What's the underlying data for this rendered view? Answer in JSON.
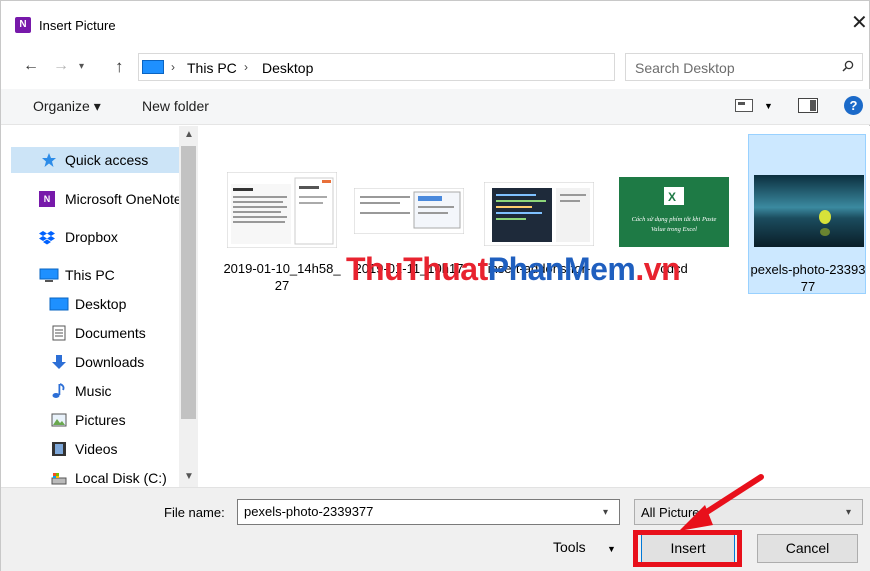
{
  "window": {
    "title": "Insert Picture",
    "app_icon_letter": "N",
    "close_glyph": "✕"
  },
  "address": {
    "crumbs": [
      "This PC",
      "Desktop"
    ],
    "separator": "›",
    "search_placeholder": "Search Desktop"
  },
  "toolbar": {
    "organize_label": "Organize ▾",
    "new_folder_label": "New folder",
    "help_label": "?"
  },
  "nav": {
    "items": [
      {
        "label": "Quick access",
        "icon": "star-icon",
        "selected": true
      },
      {
        "label": "Microsoft OneNote",
        "icon": "onenote-icon",
        "selected": false
      },
      {
        "label": "Dropbox",
        "icon": "dropbox-icon",
        "selected": false
      },
      {
        "label": "This PC",
        "icon": "pc-icon",
        "selected": false
      },
      {
        "label": "Desktop",
        "icon": "desktop-icon",
        "selected": false
      },
      {
        "label": "Documents",
        "icon": "documents-icon",
        "selected": false
      },
      {
        "label": "Downloads",
        "icon": "downloads-icon",
        "selected": false
      },
      {
        "label": "Music",
        "icon": "music-icon",
        "selected": false
      },
      {
        "label": "Pictures",
        "icon": "pictures-icon",
        "selected": false
      },
      {
        "label": "Videos",
        "icon": "videos-icon",
        "selected": false
      },
      {
        "label": "Local Disk (C:)",
        "icon": "disk-icon",
        "selected": false
      }
    ]
  },
  "files": [
    {
      "label": "2019-01-10_14h58_27",
      "thumb": "screenshot-doc",
      "selected": false
    },
    {
      "label": "2019-01-11_10h17",
      "thumb": "screenshot-doc2",
      "selected": false
    },
    {
      "label": "insert-addons-for-",
      "thumb": "screenshot-code",
      "selected": false
    },
    {
      "label": "cdcd",
      "thumb": "excel-green",
      "selected": false,
      "thumb_title": "Cách sử dụng phím tắt khi Paste Value trong Excel"
    },
    {
      "label": "pexels-photo-2339377",
      "thumb": "photo",
      "selected": true
    }
  ],
  "watermark": {
    "part1": "ThuThuat",
    "part2": "PhanMem",
    "part3": ".vn"
  },
  "bottom": {
    "file_name_label": "File name:",
    "file_name_value": "pexels-photo-2339377",
    "filter_value": "All Pictures",
    "tools_label": "Tools",
    "insert_label": "Insert",
    "cancel_label": "Cancel"
  },
  "colors": {
    "selection": "#cce8ff",
    "nav_selection": "#cce4f7",
    "annotation_red": "#e8101b",
    "onenote_purple": "#7719aa",
    "help_blue": "#1b6ac9"
  }
}
